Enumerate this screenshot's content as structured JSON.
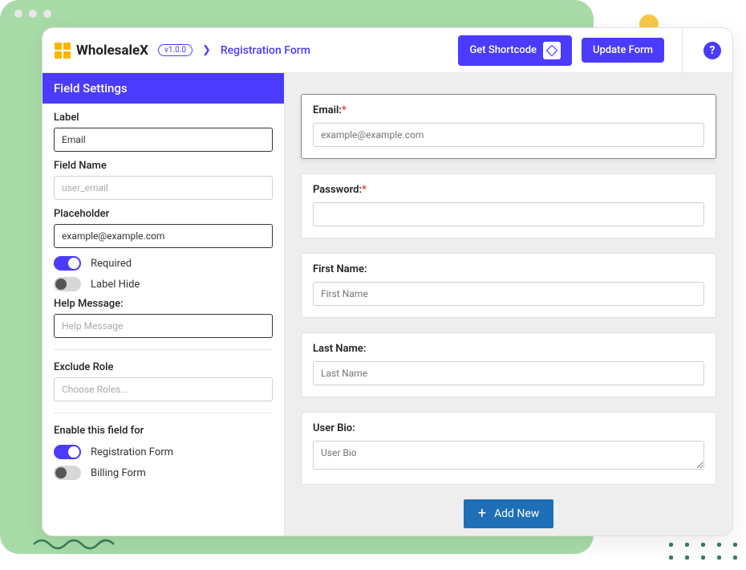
{
  "header": {
    "brand": "WholesaleX",
    "version": "v1.0.0",
    "breadcrumb": "Registration Form",
    "btn_shortcode": "Get Shortcode",
    "btn_update": "Update Form",
    "help": "?"
  },
  "sidebar": {
    "title": "Field Settings",
    "label_fld": {
      "label": "Label",
      "value": "Email"
    },
    "fieldname_fld": {
      "label": "Field Name",
      "placeholder": "user_email"
    },
    "placeholder_fld": {
      "label": "Placeholder",
      "value": "example@example.com"
    },
    "required_toggle": "Required",
    "labelhide_toggle": "Label Hide",
    "help_fld": {
      "label": "Help Message:",
      "placeholder": "Help Message"
    },
    "exclude_fld": {
      "label": "Exclude Role",
      "placeholder": "Choose Roles..."
    },
    "enable_section": "Enable this field for",
    "enable_reg": "Registration Form",
    "enable_billing": "Billing Form"
  },
  "preview": {
    "email": {
      "label": "Email:",
      "placeholder": "example@example.com"
    },
    "password": {
      "label": "Password:"
    },
    "first": {
      "label": "First Name:",
      "placeholder": "First Name"
    },
    "last": {
      "label": "Last Name:",
      "placeholder": "Last Name"
    },
    "bio": {
      "label": "User Bio:",
      "placeholder": "User Bio"
    },
    "add_btn": "Add New"
  }
}
